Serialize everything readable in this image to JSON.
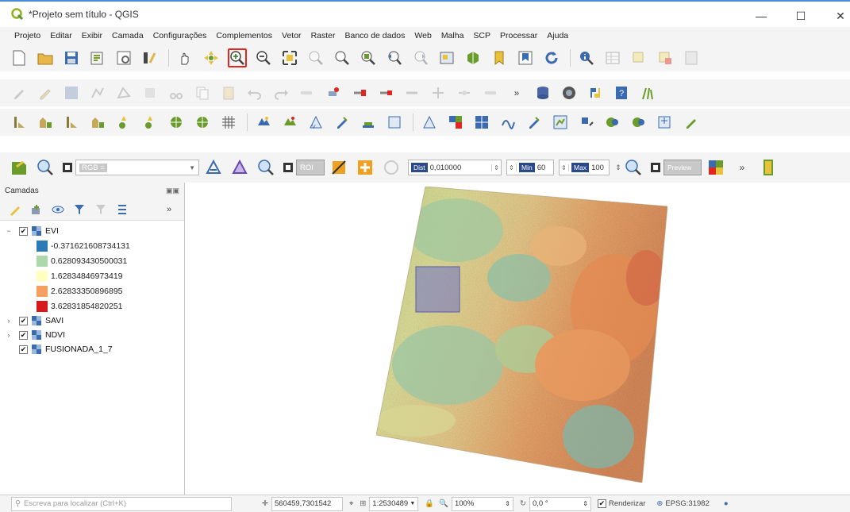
{
  "window": {
    "title": "*Projeto sem título - QGIS",
    "minimize": "—",
    "maximize": "☐",
    "close": "✕"
  },
  "menu": [
    {
      "label": "Projeto"
    },
    {
      "label": "Editar"
    },
    {
      "label": "Exibir"
    },
    {
      "label": "Camada"
    },
    {
      "label": "Configurações"
    },
    {
      "label": "Complementos"
    },
    {
      "label": "Vetor"
    },
    {
      "label": "Raster"
    },
    {
      "label": "Banco de dados"
    },
    {
      "label": "Web"
    },
    {
      "label": "Malha"
    },
    {
      "label": "SCP"
    },
    {
      "label": "Processar"
    },
    {
      "label": "Ajuda"
    }
  ],
  "toolbar": {
    "selected_tool": "zoom-in-icon",
    "scp_band_combo": "RGB =",
    "roi_label": "ROI",
    "dist_tag": "Dist",
    "dist_value": "0,010000",
    "min_tag": "Min",
    "min_value": "60",
    "max_tag": "Max",
    "max_value": "100",
    "preview_label": "Preview",
    "more": "»"
  },
  "layers_panel": {
    "title": "Camadas",
    "more": "»",
    "layers": [
      {
        "name": "EVI",
        "checked": true,
        "expanded": true
      },
      {
        "name": "SAVI",
        "checked": true,
        "expanded": false
      },
      {
        "name": "NDVI",
        "checked": true,
        "expanded": false
      },
      {
        "name": "FUSIONADA_1_7",
        "checked": true,
        "expanded": false
      }
    ],
    "legend": [
      {
        "label": "-0.371621608734131",
        "color": "#2c7bb6"
      },
      {
        "label": "0.628093430500031",
        "color": "#abd9a9"
      },
      {
        "label": "1.62834846973419",
        "color": "#ffffbf"
      },
      {
        "label": "2.62833350896895",
        "color": "#f5a05e"
      },
      {
        "label": "3.62831854820251",
        "color": "#d7191c"
      }
    ]
  },
  "status": {
    "search_placeholder": "Escreva para localizar (Ctrl+K)",
    "coordinate": "560459,7301542",
    "scale": "1:2530489",
    "magnifier": "100%",
    "rotation": "0,0 °",
    "render_label": "Renderizar",
    "render_checked": true,
    "crs": "EPSG:31982"
  }
}
